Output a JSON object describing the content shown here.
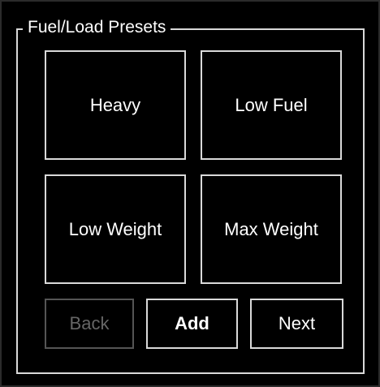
{
  "panel": {
    "title": "Fuel/Load Presets"
  },
  "presets": [
    {
      "label": "Heavy"
    },
    {
      "label": "Low Fuel"
    },
    {
      "label": "Low Weight"
    },
    {
      "label": "Max Weight"
    }
  ],
  "navigation": {
    "back_label": "Back",
    "back_enabled": false,
    "add_label": "Add",
    "next_label": "Next"
  },
  "colors": {
    "background": "#000000",
    "border": "#d9d9d9",
    "text": "#ffffff",
    "disabled_text": "#666666",
    "disabled_border": "#555555"
  }
}
